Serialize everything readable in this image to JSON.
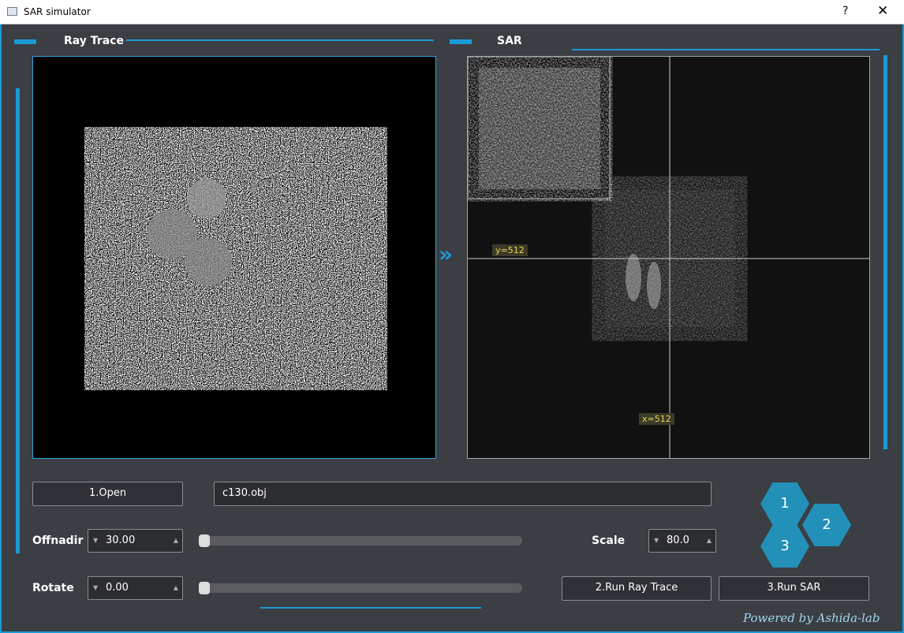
{
  "window": {
    "title": "SAR simulator",
    "help": "?",
    "close": "✕"
  },
  "panels": {
    "ray_trace": "Ray Trace",
    "sar": "SAR",
    "crosshair_y": "y=512",
    "crosshair_x": "x=512"
  },
  "controls": {
    "open_label": "1.Open",
    "filename": "c130.obj",
    "offnadir_label": "Offnadir",
    "offnadir_value": "30.00",
    "offnadir_slider": 0,
    "rotate_label": "Rotate",
    "rotate_value": "0.00",
    "rotate_slider": 0,
    "scale_label": "Scale",
    "scale_value": "80.0",
    "run_ray_trace": "2.Run Ray Trace",
    "run_sar": "3.Run SAR"
  },
  "steps": [
    "1",
    "2",
    "3"
  ],
  "footer": "Powered by Ashida-lab",
  "colors": {
    "accent": "#1a9ad6",
    "hex": "#2290b8"
  }
}
